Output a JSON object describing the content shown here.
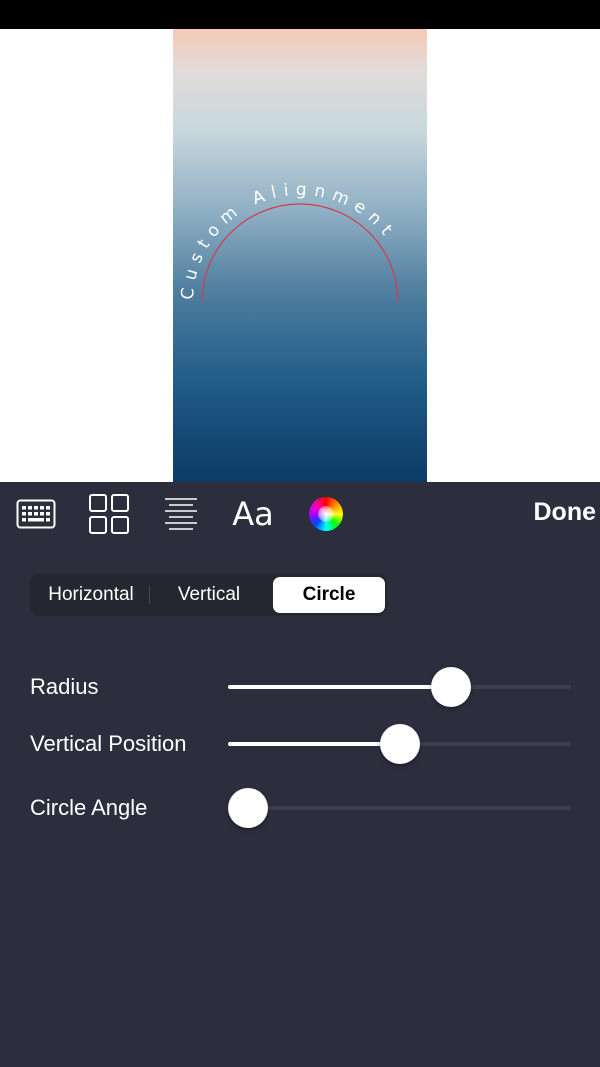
{
  "preview": {
    "curved_text": "Custom Alignment"
  },
  "toolbar": {
    "tools": [
      "keyboard-icon",
      "grid-icon",
      "text-align-icon",
      "font-icon",
      "color-wheel-icon"
    ],
    "font_label": "Aa",
    "done_label": "Done"
  },
  "alignment": {
    "options": [
      "Horizontal",
      "Vertical",
      "Circle"
    ],
    "selected": "Circle"
  },
  "sliders": {
    "radius": {
      "label": "Radius",
      "value": 0.67
    },
    "vertical_position": {
      "label": "Vertical Position",
      "value": 0.5
    },
    "circle_angle": {
      "label": "Circle Angle",
      "value": 0.0
    }
  },
  "colors": {
    "panel_bg": "#2d2e3d",
    "arc_color": "#d23a52",
    "accent": "#ffffff"
  }
}
